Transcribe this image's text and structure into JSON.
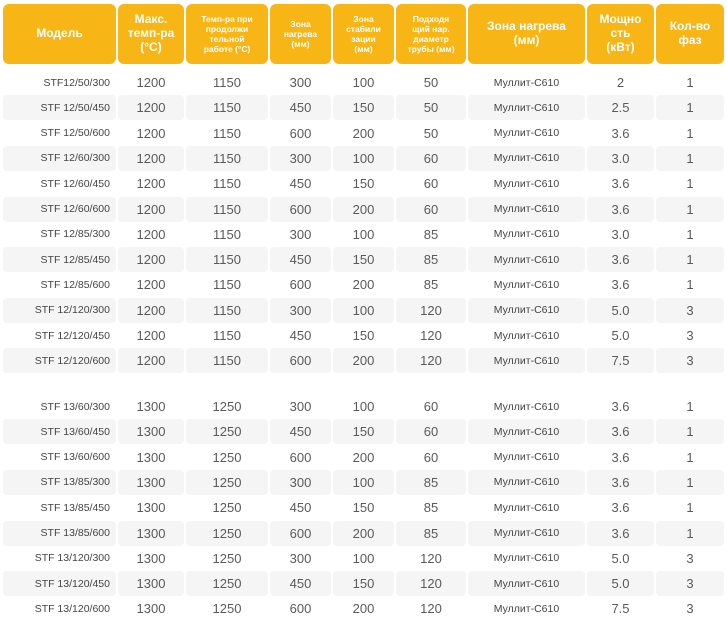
{
  "header": {
    "columns": [
      "Модель",
      "Макс.\nтемп-ра\n(°С)",
      "Темп-ра при\nпродолжи\nтельной\nработе (°С)",
      "Зона\nнагрева\n(мм)",
      "Зона\nстабили\nзации\n(мм)",
      "Подходя\nщий нар.\nдиаметр\nтрубы (мм)",
      "Зона нагрева\n(мм)",
      "Мощно\nсть\n(кВт)",
      "Кол-во\nфаз"
    ]
  },
  "groups": [
    {
      "rows": [
        [
          "STF12/50/300",
          "1200",
          "1150",
          "300",
          "100",
          "50",
          "Муллит-С610",
          "2",
          "1"
        ],
        [
          "STF 12/50/450",
          "1200",
          "1150",
          "450",
          "150",
          "50",
          "Муллит-С610",
          "2.5",
          "1"
        ],
        [
          "STF 12/50/600",
          "1200",
          "1150",
          "600",
          "200",
          "50",
          "Муллит-С610",
          "3.6",
          "1"
        ],
        [
          "STF 12/60/300",
          "1200",
          "1150",
          "300",
          "100",
          "60",
          "Муллит-С610",
          "3.0",
          "1"
        ],
        [
          "STF 12/60/450",
          "1200",
          "1150",
          "450",
          "150",
          "60",
          "Муллит-С610",
          "3.6",
          "1"
        ],
        [
          "STF 12/60/600",
          "1200",
          "1150",
          "600",
          "200",
          "60",
          "Муллит-С610",
          "3.6",
          "1"
        ],
        [
          "STF 12/85/300",
          "1200",
          "1150",
          "300",
          "100",
          "85",
          "Муллит-С610",
          "3.0",
          "1"
        ],
        [
          "STF 12/85/450",
          "1200",
          "1150",
          "450",
          "150",
          "85",
          "Муллит-С610",
          "3.6",
          "1"
        ],
        [
          "STF 12/85/600",
          "1200",
          "1150",
          "600",
          "200",
          "85",
          "Муллит-С610",
          "3.6",
          "1"
        ],
        [
          "STF 12/120/300",
          "1200",
          "1150",
          "300",
          "100",
          "120",
          "Муллит-С610",
          "5.0",
          "3"
        ],
        [
          "STF 12/120/450",
          "1200",
          "1150",
          "450",
          "150",
          "120",
          "Муллит-С610",
          "5.0",
          "3"
        ],
        [
          "STF 12/120/600",
          "1200",
          "1150",
          "600",
          "200",
          "120",
          "Муллит-С610",
          "7.5",
          "3"
        ]
      ]
    },
    {
      "rows": [
        [
          "STF 13/60/300",
          "1300",
          "1250",
          "300",
          "100",
          "60",
          "Муллит-С610",
          "3.6",
          "1"
        ],
        [
          "STF 13/60/450",
          "1300",
          "1250",
          "450",
          "150",
          "60",
          "Муллит-С610",
          "3.6",
          "1"
        ],
        [
          "STF 13/60/600",
          "1300",
          "1250",
          "600",
          "200",
          "60",
          "Муллит-С610",
          "3.6",
          "1"
        ],
        [
          "STF 13/85/300",
          "1300",
          "1250",
          "300",
          "100",
          "85",
          "Муллит-С610",
          "3.6",
          "1"
        ],
        [
          "STF 13/85/450",
          "1300",
          "1250",
          "450",
          "150",
          "85",
          "Муллит-С610",
          "3.6",
          "1"
        ],
        [
          "STF 13/85/600",
          "1300",
          "1250",
          "600",
          "200",
          "85",
          "Муллит-С610",
          "3.6",
          "1"
        ],
        [
          "STF 13/120/300",
          "1300",
          "1250",
          "300",
          "100",
          "120",
          "Муллит-С610",
          "5.0",
          "3"
        ],
        [
          "STF 13/120/450",
          "1300",
          "1250",
          "450",
          "150",
          "120",
          "Муллит-С610",
          "5.0",
          "3"
        ],
        [
          "STF 13/120/600",
          "1300",
          "1250",
          "600",
          "200",
          "120",
          "Муллит-С610",
          "7.5",
          "3"
        ]
      ]
    }
  ],
  "colors": {
    "header_bg": "#f7b516",
    "header_text": "#ffffff",
    "row_alt_bg": "#f5f5f5",
    "cell_text": "#5a5a5a"
  }
}
